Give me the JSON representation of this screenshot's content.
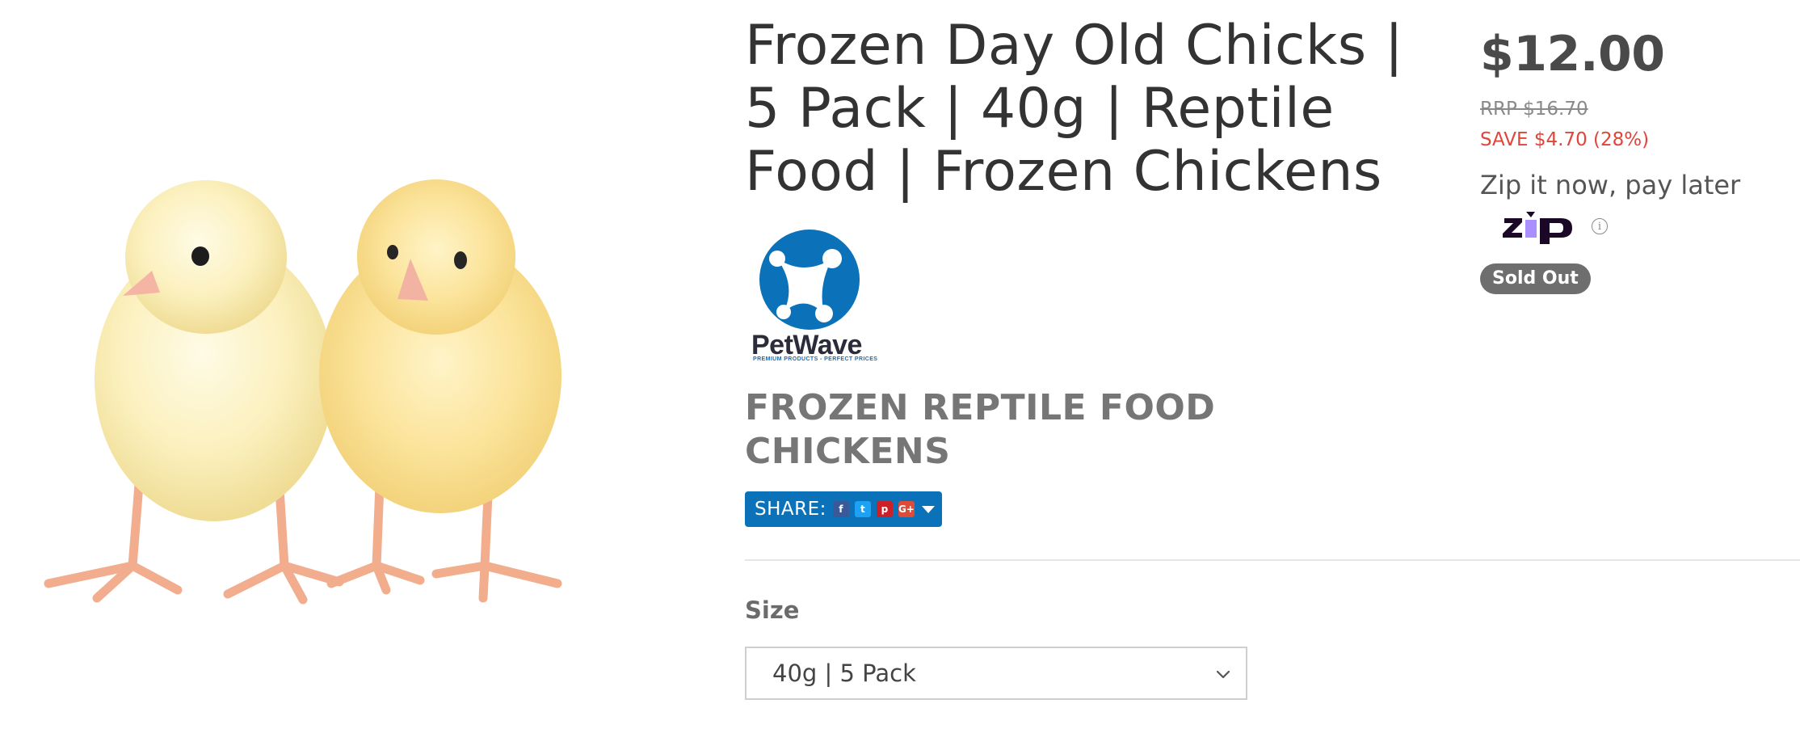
{
  "product": {
    "image_alt": "two baby chicks",
    "title": "Frozen Day Old Chicks | 5 Pack | 40g | Reptile Food | Frozen Chickens",
    "category": "FROZEN REPTILE FOOD CHICKENS"
  },
  "brand": {
    "name": "PetWave",
    "tagline": "PREMIUM PRODUCTS - PERFECT PRICES",
    "color": "#0b71b8"
  },
  "share": {
    "label": "SHARE:",
    "icons": [
      "facebook-icon",
      "twitter-icon",
      "pinterest-icon",
      "google-plus-icon",
      "chevron-down-icon"
    ],
    "facebook_glyph": "f",
    "twitter_glyph": "t",
    "pinterest_glyph": "p",
    "google_plus_glyph": "G+"
  },
  "pricing": {
    "price": "$12.00",
    "rrp": "RRP $16.70",
    "save": "SAVE $4.70 (28%)",
    "save_color": "#e0453a"
  },
  "zip": {
    "text": "Zip it now, pay later",
    "logo_text": "zip",
    "info_glyph": "i"
  },
  "status": {
    "badge": "Sold Out"
  },
  "variant": {
    "label": "Size",
    "selected": "40g | 5 Pack"
  }
}
